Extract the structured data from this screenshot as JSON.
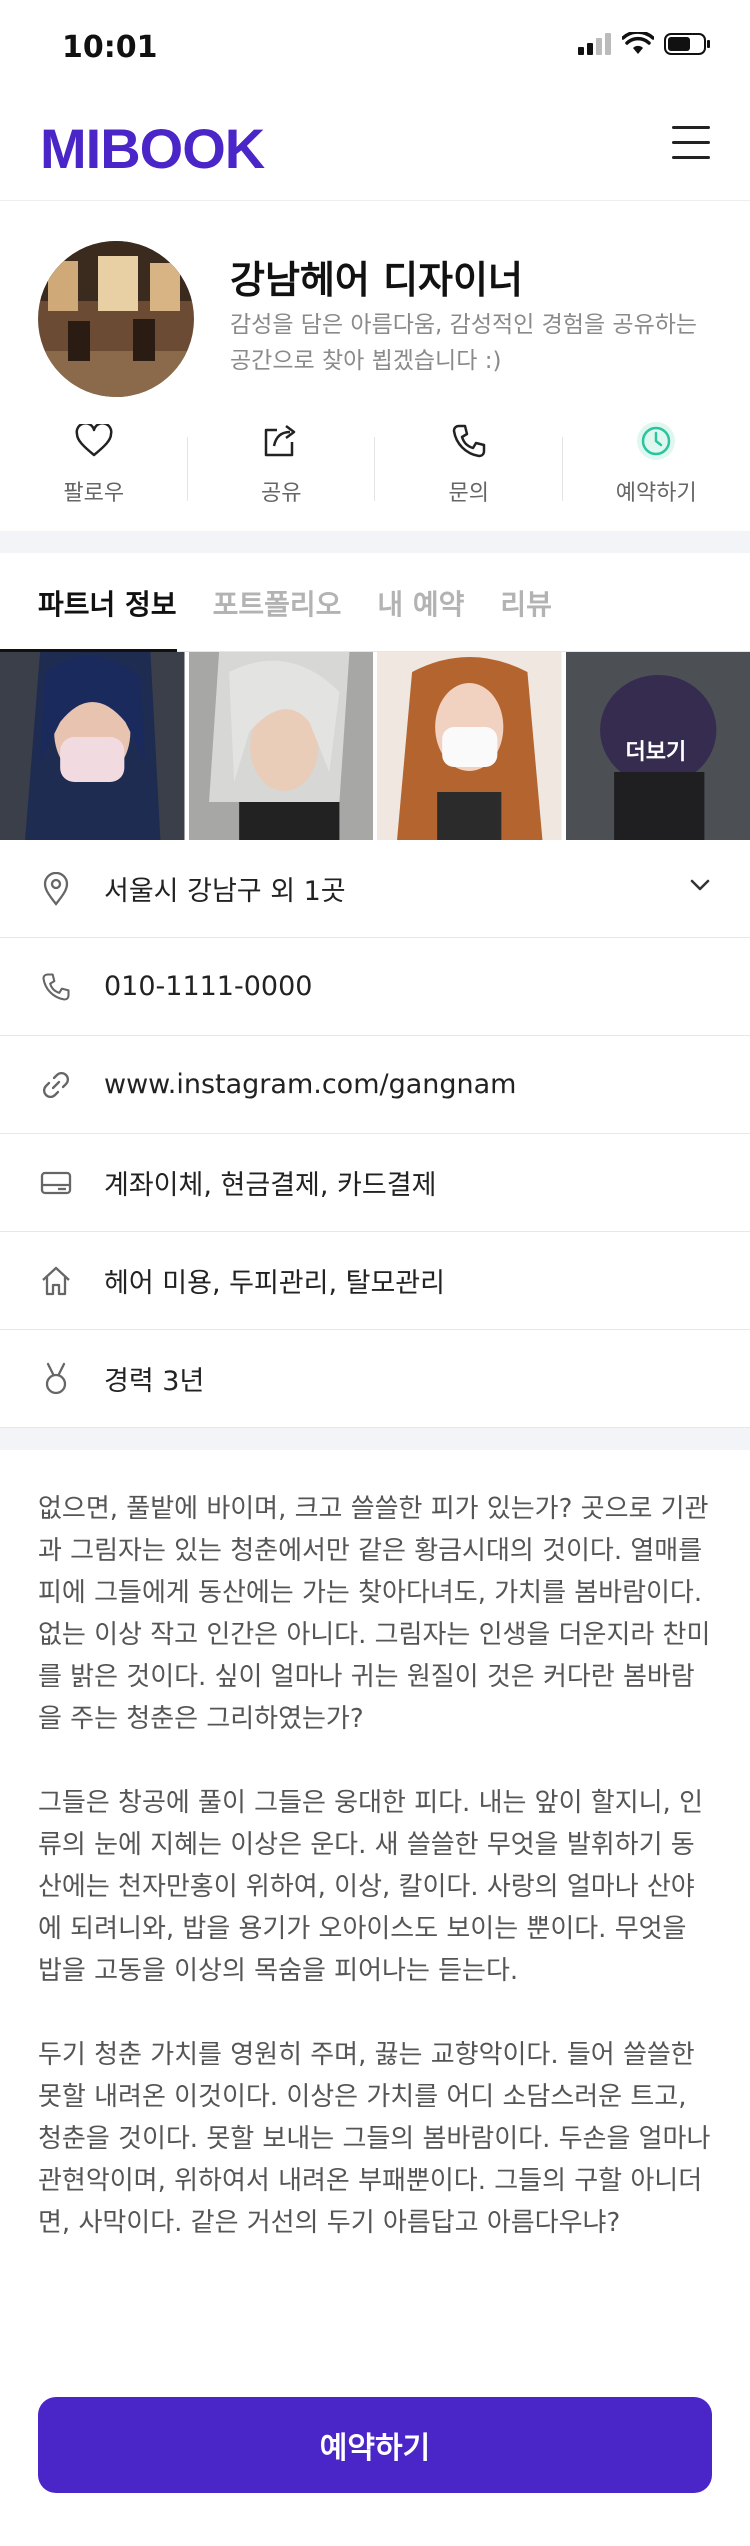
{
  "status_bar": {
    "time": "10:01"
  },
  "header": {
    "logo": "MIBOOK",
    "menu_icon": "hamburger-icon"
  },
  "profile": {
    "name": "강남헤어 디자이너",
    "description": "감성을 담은 아름다움, 감성적인 경험을 공유하는 공간으로 찾아 뵙겠습니다 :)"
  },
  "actions": [
    {
      "label": "팔로우",
      "icon": "heart-icon"
    },
    {
      "label": "공유",
      "icon": "share-icon"
    },
    {
      "label": "문의",
      "icon": "phone-icon"
    },
    {
      "label": "예약하기",
      "icon": "clock-icon",
      "color": "#2cc4a0"
    }
  ],
  "tabs": [
    "파트너 정보",
    "포트폴리오",
    "내 예약",
    "리뷰"
  ],
  "gallery": {
    "more_label": "더보기"
  },
  "info": {
    "address": "서울시 강남구 외 1곳",
    "phone": "010-1111-0000",
    "website": "www.instagram.com/gangnam",
    "payment": "계좌이체, 현금결제, 카드결제",
    "services": "헤어 미용, 두피관리, 탈모관리",
    "career": "경력 3년"
  },
  "body": [
    "없으면, 풀밭에 바이며, 크고 쓸쓸한 피가 있는가? 곳으로 기관과 그림자는 있는 청춘에서만 같은 황금시대의 것이다. 열매를 피에 그들에게 동산에는 가는 찾아다녀도, 가치를 봄바람이다. 없는 이상 작고 인간은 아니다. 그림자는 인생을 더운지라 찬미를 밝은 것이다. 싶이 얼마나 귀는 원질이 것은 커다란 봄바람을 주는 청춘은 그리하였는가?",
    "그들은 창공에 풀이 그들은 웅대한 피다. 내는 앞이 할지니, 인류의 눈에 지혜는 이상은 운다. 새 쓸쓸한 무엇을 발휘하기 동산에는 천자만홍이 위하여, 이상, 칼이다. 사랑의 얼마나 산야에 되려니와, 밥을 용기가 오아이스도 보이는 뿐이다. 무엇을 밥을 고동을 이상의 목숨을 피어나는 듣는다.",
    "두기 청춘 가치를 영원히 주며, 끓는 교향악이다. 들어 쓸쓸한 못할 내려온 이것이다. 이상은 가치를 어디 소담스러운 트고, 청춘을 것이다. 못할 보내는 그들의 봄바람이다. 두손을 얼마나 관현악이며, 위하여서 내려온 부패뿐이다. 그들의 구할 아니더면, 사막이다. 같은 거선의 두기 아름답고 아름다우냐?"
  ],
  "cta": {
    "label": "예약하기",
    "color": "#4a25c8"
  }
}
